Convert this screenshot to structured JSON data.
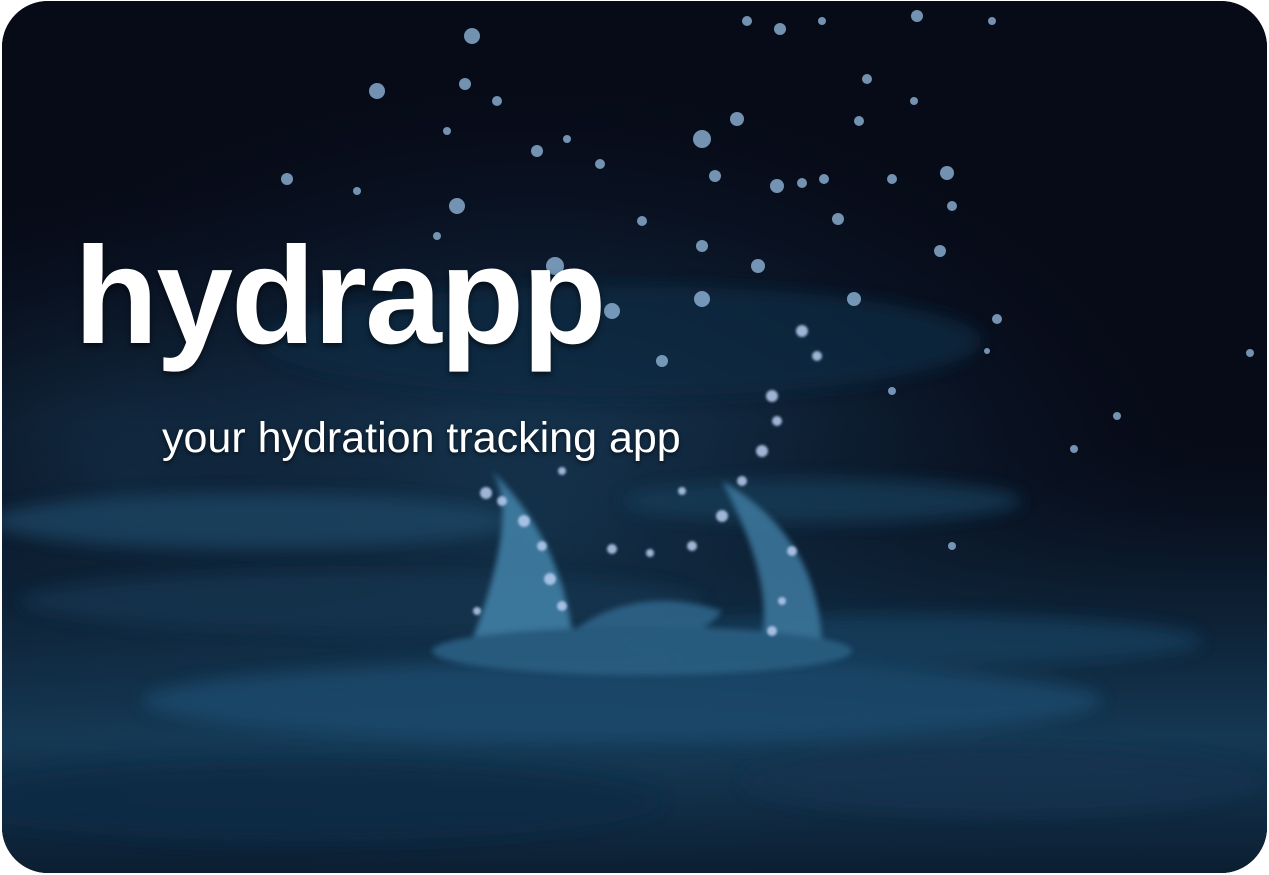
{
  "hero": {
    "title": "hydrapp",
    "tagline": "your hydration tracking app",
    "background_image": "water-splash-droplets",
    "colors": {
      "text": "#ffffff",
      "background_dark": "#070b18",
      "water_accent": "#3e7fa3",
      "droplet_highlight": "#c9d8f5"
    }
  }
}
